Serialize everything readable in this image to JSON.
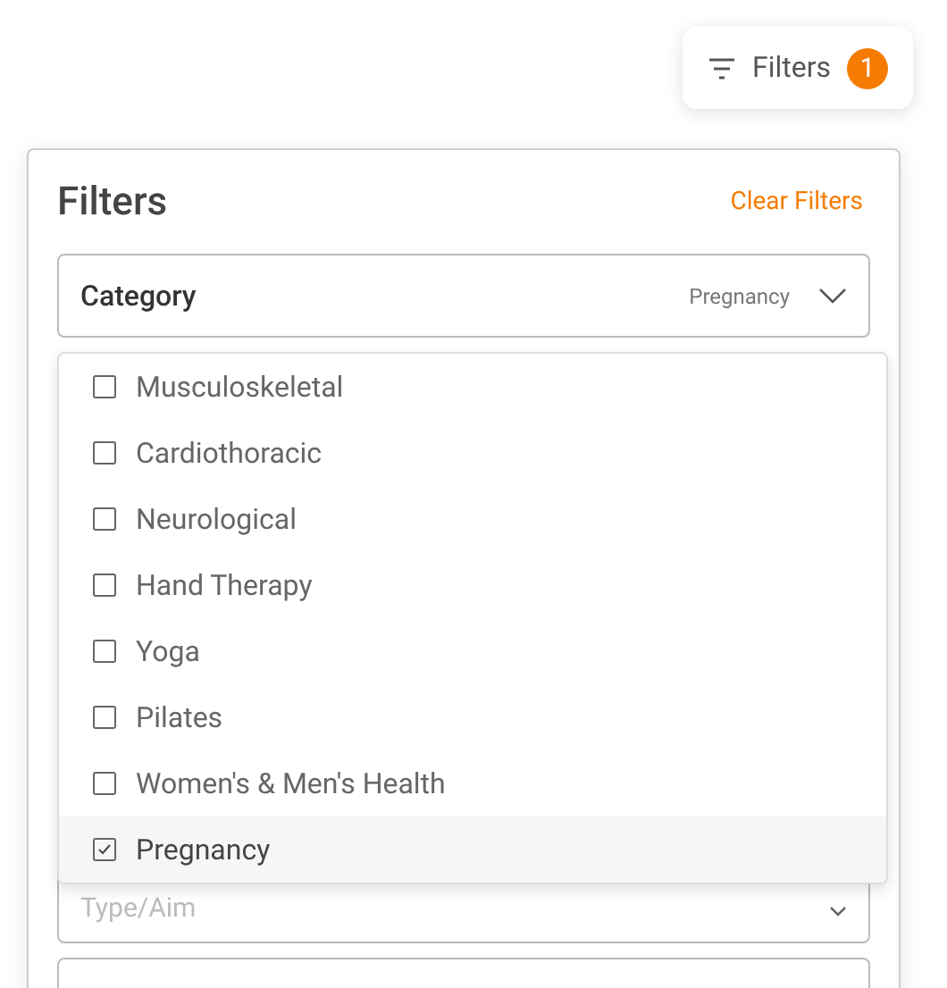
{
  "filters_button": {
    "label": "Filters",
    "count": "1"
  },
  "panel": {
    "title": "Filters",
    "clear_link": "Clear Filters",
    "category": {
      "label": "Category",
      "value": "Pregnancy",
      "expanded": true,
      "options": [
        {
          "label": "Musculoskeletal",
          "checked": false
        },
        {
          "label": "Cardiothoracic",
          "checked": false
        },
        {
          "label": "Neurological",
          "checked": false
        },
        {
          "label": "Hand Therapy",
          "checked": false
        },
        {
          "label": "Yoga",
          "checked": false
        },
        {
          "label": "Pilates",
          "checked": false
        },
        {
          "label": "Women's & Men's Health",
          "checked": false
        },
        {
          "label": "Pregnancy",
          "checked": true
        }
      ]
    },
    "type_select": {
      "placeholder": "Type/Aim"
    }
  }
}
